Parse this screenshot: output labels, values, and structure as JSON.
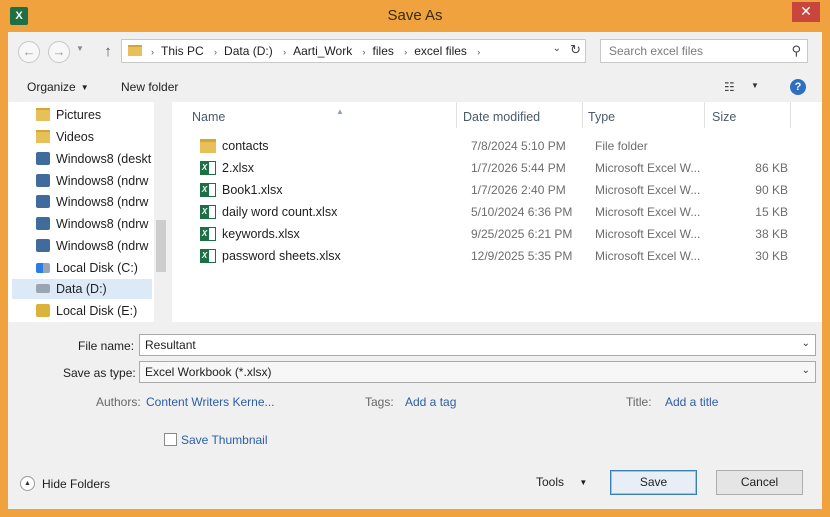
{
  "window": {
    "title": "Save As",
    "app_icon": "excel-icon",
    "close_glyph": "✕"
  },
  "nav": {
    "back_glyph": "←",
    "forward_glyph": "→",
    "up_glyph": "↑"
  },
  "address": {
    "breadcrumbs": [
      "This PC",
      "Data (D:)",
      "Aarti_Work",
      "files",
      "excel files"
    ],
    "separator": "›",
    "dropdown_glyph": "⌄",
    "refresh_glyph": "↻"
  },
  "search": {
    "placeholder": "Search excel files",
    "icon_glyph": "⚲"
  },
  "toolbar": {
    "organize": "Organize",
    "new_folder": "New folder",
    "caret": "▼",
    "view_glyph": "☷",
    "help": "?"
  },
  "navpane": {
    "items": [
      {
        "label": "Pictures",
        "icon": "folder-icon"
      },
      {
        "label": "Videos",
        "icon": "folder-icon"
      },
      {
        "label": "Windows8 (deskt",
        "icon": "network-drive-icon"
      },
      {
        "label": "Windows8 (ndrw",
        "icon": "network-drive-icon"
      },
      {
        "label": "Windows8 (ndrw",
        "icon": "network-drive-icon"
      },
      {
        "label": "Windows8 (ndrw",
        "icon": "network-drive-icon"
      },
      {
        "label": "Windows8 (ndrw",
        "icon": "network-drive-icon"
      },
      {
        "label": "Local Disk (C:)",
        "icon": "windows-disk-icon"
      },
      {
        "label": "Data (D:)",
        "icon": "disk-icon",
        "selected": true
      },
      {
        "label": "Local Disk (E:)",
        "icon": "locked-disk-icon"
      }
    ]
  },
  "files": {
    "columns": {
      "name": "Name",
      "date": "Date modified",
      "type": "Type",
      "size": "Size"
    },
    "sort_glyph": "▲",
    "rows": [
      {
        "name": "contacts",
        "date": "7/8/2024 5:10 PM",
        "type": "File folder",
        "size": "",
        "kind": "folder"
      },
      {
        "name": "2.xlsx",
        "date": "1/7/2026 5:44 PM",
        "type": "Microsoft Excel W...",
        "size": "86 KB",
        "kind": "excel"
      },
      {
        "name": "Book1.xlsx",
        "date": "1/7/2026 2:40 PM",
        "type": "Microsoft Excel W...",
        "size": "90 KB",
        "kind": "excel"
      },
      {
        "name": "daily word count.xlsx",
        "date": "5/10/2024 6:36 PM",
        "type": "Microsoft Excel W...",
        "size": "15 KB",
        "kind": "excel"
      },
      {
        "name": "keywords.xlsx",
        "date": "9/25/2025 6:21 PM",
        "type": "Microsoft Excel W...",
        "size": "38 KB",
        "kind": "excel"
      },
      {
        "name": "password sheets.xlsx",
        "date": "12/9/2025 5:35 PM",
        "type": "Microsoft Excel W...",
        "size": "30 KB",
        "kind": "excel"
      }
    ]
  },
  "form": {
    "file_name_label": "File name:",
    "file_name_value": "Resultant",
    "save_type_label": "Save as type:",
    "save_type_value": "Excel Workbook (*.xlsx)",
    "dropdown_glyph": "⌄",
    "authors_label": "Authors:",
    "authors_value": "Content Writers Kerne...",
    "tags_label": "Tags:",
    "tags_value": "Add a tag",
    "title_label": "Title:",
    "title_value": "Add a title",
    "thumbnail_label": "Save Thumbnail",
    "thumbnail_checked": false
  },
  "footer": {
    "hide_folders": "Hide Folders",
    "hide_glyph": "▲",
    "tools": "Tools",
    "tools_caret": "▼",
    "save": "Save",
    "cancel": "Cancel"
  }
}
